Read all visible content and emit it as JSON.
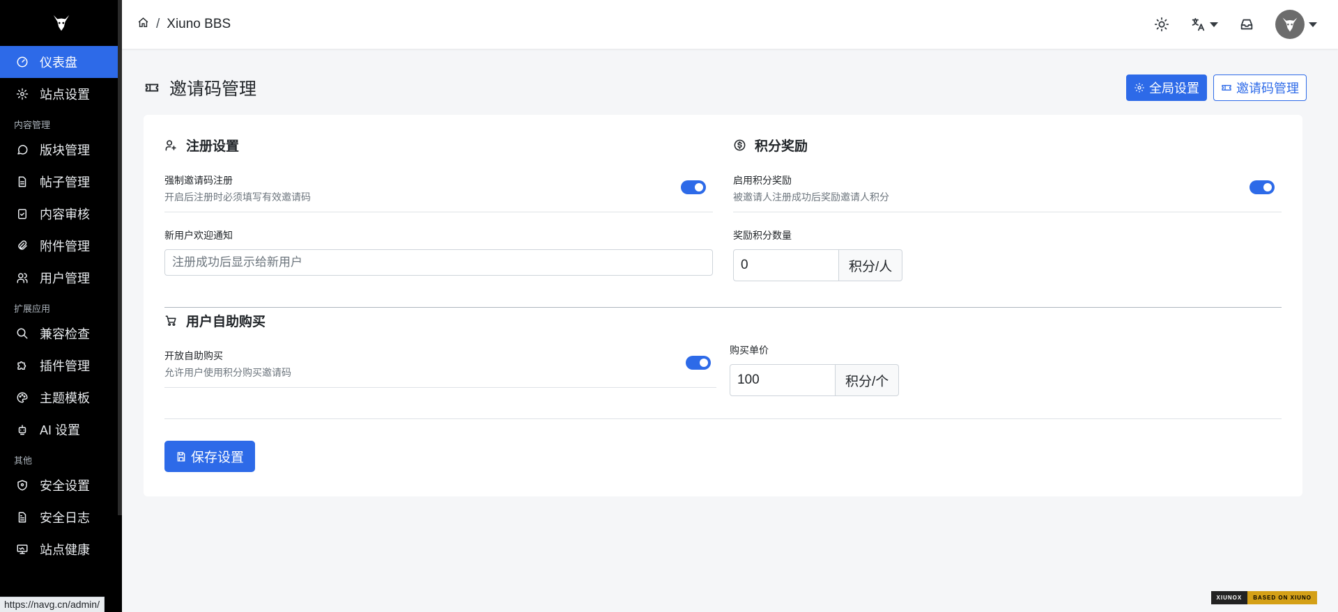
{
  "sidebar": {
    "items": [
      {
        "label": "仪表盘",
        "icon": "dashboard-icon",
        "active": true
      },
      {
        "label": "站点设置",
        "icon": "gear-icon"
      }
    ],
    "section_content": "内容管理",
    "content_items": [
      {
        "label": "版块管理",
        "icon": "message-icon"
      },
      {
        "label": "帖子管理",
        "icon": "file-icon"
      },
      {
        "label": "内容审核",
        "icon": "clipboard-check-icon"
      },
      {
        "label": "附件管理",
        "icon": "paperclip-icon"
      },
      {
        "label": "用户管理",
        "icon": "users-icon"
      }
    ],
    "section_extend": "扩展应用",
    "extend_items": [
      {
        "label": "兼容检查",
        "icon": "search-icon"
      },
      {
        "label": "插件管理",
        "icon": "puzzle-icon"
      },
      {
        "label": "主题模板",
        "icon": "palette-icon"
      },
      {
        "label": "AI 设置",
        "icon": "robot-icon"
      }
    ],
    "section_other": "其他",
    "other_items": [
      {
        "label": "安全设置",
        "icon": "shield-icon"
      },
      {
        "label": "安全日志",
        "icon": "file-text-icon"
      },
      {
        "label": "站点健康",
        "icon": "monitor-icon"
      }
    ]
  },
  "topbar": {
    "breadcrumb_sep": "/",
    "site_name": "Xiuno BBS"
  },
  "page": {
    "title": "邀请码管理",
    "global_settings_btn": "全局设置",
    "invite_manage_btn": "邀请码管理"
  },
  "register": {
    "title": "注册设置",
    "force_label": "强制邀请码注册",
    "force_desc": "开启后注册时必须填写有效邀请码",
    "force_enabled": true,
    "welcome_label": "新用户欢迎通知",
    "welcome_placeholder": "注册成功后显示给新用户"
  },
  "reward": {
    "title": "积分奖励",
    "enable_label": "启用积分奖励",
    "enable_desc": "被邀请人注册成功后奖励邀请人积分",
    "enabled": true,
    "amount_label": "奖励积分数量",
    "amount_value": "0",
    "amount_unit": "积分/人"
  },
  "purchase": {
    "title": "用户自助购买",
    "open_label": "开放自助购买",
    "open_desc": "允许用户使用积分购买邀请码",
    "open_enabled": true,
    "price_label": "购买单价",
    "price_value": "100",
    "price_unit": "积分/个"
  },
  "save_btn": "保存设置",
  "status_url": "https://navg.cn/admin/",
  "footer_badge": {
    "left": "XIUNOX",
    "right": "BASED ON XIUNO"
  },
  "colors": {
    "primary": "#2d6ae8",
    "sidebar_bg": "#000000"
  }
}
